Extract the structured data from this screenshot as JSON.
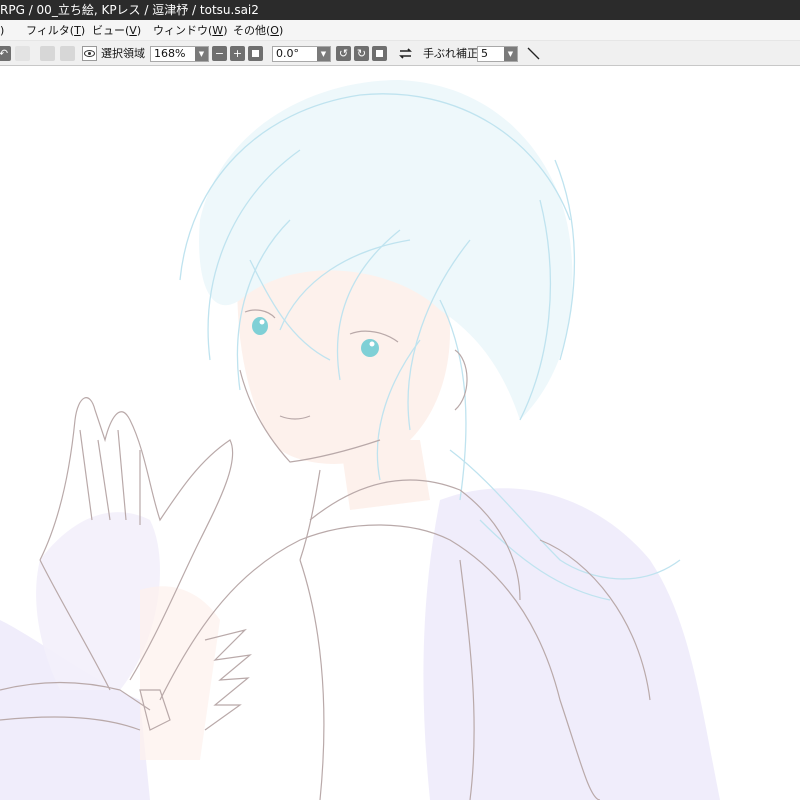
{
  "window": {
    "title": "RPG / 00_立ち絵, KPレス / 逗津杼 / totsu.sai2"
  },
  "menu": {
    "items": [
      {
        "label": "フィルタ(",
        "key": "T",
        "end": ")"
      },
      {
        "label": "ビュー(",
        "key": "V",
        "end": ")"
      },
      {
        "label": "ウィンドウ(",
        "key": "W",
        "end": ")"
      },
      {
        "label": "その他(",
        "key": "O",
        "end": ")"
      }
    ],
    "partial": ")"
  },
  "toolbar": {
    "selection_label": "選択領域",
    "zoom_value": "168%",
    "rotation_value": "0.0°",
    "stabilizer_label": "手ぶれ補正",
    "stabilizer_value": "5",
    "icons": {
      "selection_view": "eye-icon",
      "zoom_out": "minus-icon",
      "zoom_in": "plus-icon",
      "zoom_reset": "square-icon",
      "rotate_ccw": "rotate-left-icon",
      "rotate_cw": "rotate-right-icon",
      "rotate_reset": "square-icon",
      "flip": "flip-horizontal-icon",
      "pen_tool": "pen-line-icon"
    }
  },
  "canvas": {
    "line_color": "#b9a9a9",
    "hair_color": "#bfe3ef",
    "shadow_color": "#ece8fa",
    "skin_color": "#fdf1ec",
    "eye_color": "#7fd0d6"
  }
}
